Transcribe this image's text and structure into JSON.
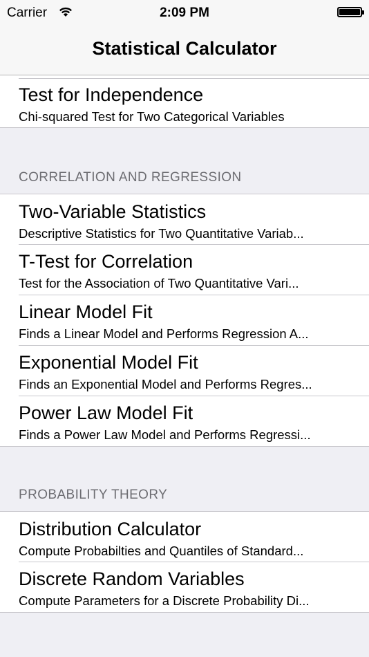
{
  "status_bar": {
    "carrier": "Carrier",
    "time": "2:09 PM"
  },
  "nav": {
    "title": "Statistical Calculator"
  },
  "top_group": {
    "items": [
      {
        "title": "Test for Independence",
        "subtitle": "Chi-squared Test for Two Categorical Variables"
      }
    ]
  },
  "sections": [
    {
      "header": "CORRELATION AND REGRESSION",
      "items": [
        {
          "title": "Two-Variable Statistics",
          "subtitle": "Descriptive Statistics for Two Quantitative Variab..."
        },
        {
          "title": "T-Test for Correlation",
          "subtitle": "Test for the Association of Two Quantitative Vari..."
        },
        {
          "title": "Linear Model Fit",
          "subtitle": "Finds a Linear Model and Performs Regression A..."
        },
        {
          "title": "Exponential Model Fit",
          "subtitle": "Finds an Exponential Model and Performs Regres..."
        },
        {
          "title": "Power Law Model Fit",
          "subtitle": "Finds a Power Law Model and Performs Regressi..."
        }
      ]
    },
    {
      "header": "PROBABILITY THEORY",
      "items": [
        {
          "title": "Distribution Calculator",
          "subtitle": "Compute Probabilties and Quantiles of Standard..."
        },
        {
          "title": "Discrete Random Variables",
          "subtitle": "Compute Parameters for a Discrete Probability Di..."
        }
      ]
    }
  ]
}
